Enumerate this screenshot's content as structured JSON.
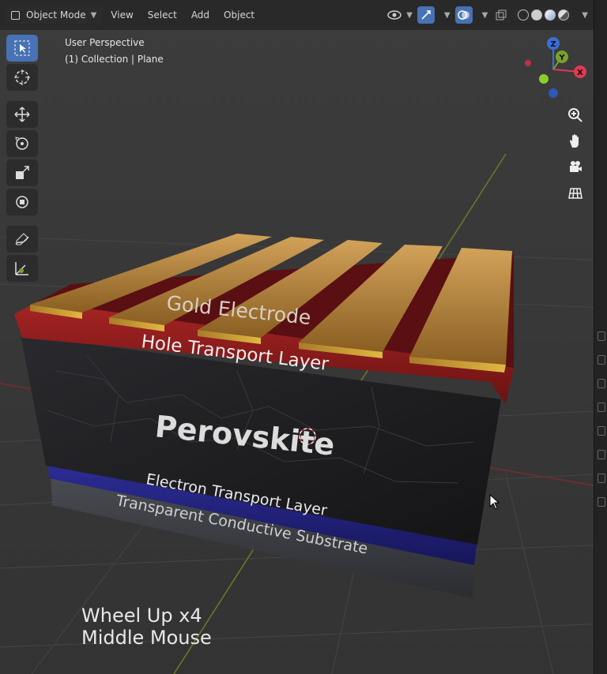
{
  "header": {
    "mode": "Object Mode",
    "menus": [
      "View",
      "Select",
      "Add",
      "Object"
    ]
  },
  "viewport_info": {
    "perspective": "User Perspective",
    "collection": "(1) Collection | Plane"
  },
  "gizmo_axes": {
    "z": "Z",
    "y": "Y",
    "x": "X"
  },
  "scene_labels": {
    "electrode": "Gold Electrode",
    "htl": "Hole Transport Layer",
    "perovskite": "Perovskite",
    "etl": "Electron Transport Layer",
    "substrate": "Transparent Conductive Substrate"
  },
  "status": {
    "line1": "Wheel Up x4",
    "line2": "Middle Mouse"
  },
  "colors": {
    "gold": "#b07f2f",
    "htl_red": "#8e1c1c",
    "perovskite": "#1f1f22",
    "etl_blue": "#2a2a8a",
    "substrate": "#3d3f44",
    "x_axis": "#e03a52",
    "y_axis": "#7aa12a",
    "z_axis": "#3a6fd8",
    "active_tool": "#4772b3"
  },
  "icons": {
    "tools": [
      "select-box-icon",
      "cursor-icon",
      "move-icon",
      "rotate-icon",
      "scale-icon",
      "transform-icon",
      "annotate-icon",
      "measure-icon"
    ],
    "nav": [
      "zoom-icon",
      "pan-hand-icon",
      "camera-icon",
      "grid-view-icon"
    ]
  }
}
